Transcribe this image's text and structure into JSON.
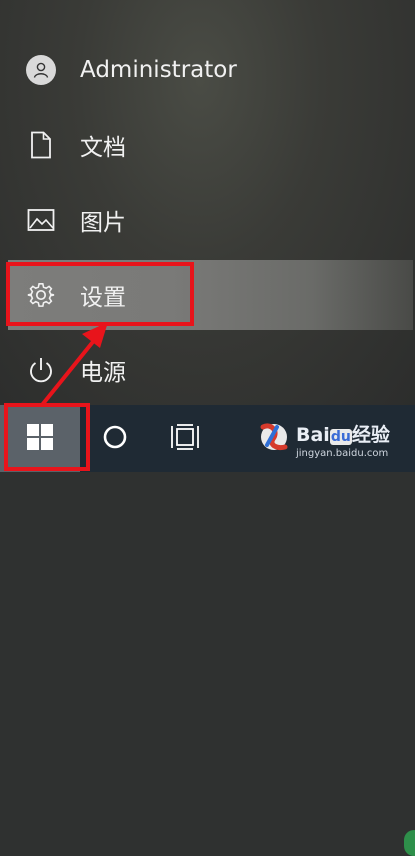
{
  "start_menu": {
    "account_label": "Administrator",
    "documents_label": "文档",
    "pictures_label": "图片",
    "settings_label": "设置",
    "power_label": "电源"
  },
  "taskbar": {
    "start_icon": "windows-logo-icon",
    "search_icon": "cortana-circle-icon",
    "taskview_icon": "task-view-icon",
    "pinned_icon": "baidu-paw-app-icon"
  },
  "watermark": {
    "brand_text": "Bai",
    "brand_du": "du",
    "brand_cn": "经验",
    "url": "jingyan.baidu.com"
  },
  "colors": {
    "highlight": "#e8141b",
    "taskbar": "#1f2a34",
    "settings_hover": "#7a7a78"
  }
}
